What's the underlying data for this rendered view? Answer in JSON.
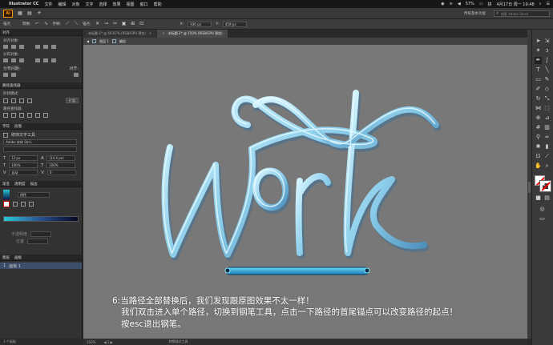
{
  "menubar": {
    "app_name": "Illustrator CC",
    "items": [
      "文件",
      "编辑",
      "对象",
      "文字",
      "选择",
      "效果",
      "视图",
      "窗口",
      "帮助"
    ],
    "battery": "57%",
    "date_time": "4月17日 周一 19:48"
  },
  "appbar": {
    "logo": "Ai",
    "workspace": "传统基本功能",
    "search_placeholder": "搜索 Adobe Stock"
  },
  "control_bar": {
    "selection_label": "锚点",
    "convert_label": "转换:",
    "handles_label": "手柄:",
    "anchor_label": "锚点:",
    "x_value": "936 px",
    "y_value": "459 px"
  },
  "doc_tabs": [
    {
      "label": "未标题-1* @ 66.67% (RGB/GPU 预览)",
      "active": false
    },
    {
      "label": "未标题-2* @ 150% (RGB/GPU 预览)",
      "active": true
    }
  ],
  "breadcrumb": {
    "layer": "图层 1",
    "group": "编组"
  },
  "left_panel": {
    "align_tab": "对齐",
    "align_objects_label": "对齐对象:",
    "distribute_objects_label": "分布对象:",
    "distribute_spacing_label": "分布间距:",
    "align_to_label": "对齐:",
    "pathfinder_tab": "路径查找器",
    "shape_modes_label": "形状模式:",
    "expand_button": "扩展",
    "pathfinders_label": "路径查找器:",
    "char_tab": "字符",
    "para_tab": "段落",
    "touch_type_label": "修饰文字工具",
    "font_family": "Adobe 宋体 Std L",
    "font_size": "12 px",
    "leading": "(14.4 px)",
    "scale_h": "100%",
    "scale_v": "100%",
    "tracking_auto": "自动",
    "tracking": "0",
    "gradient_tab": "渐变",
    "transparency_tab": "透明度",
    "stroke_tab": "描边",
    "gradient_type": "线性",
    "opacity_label": "不透明度",
    "position_label": "位置",
    "layers_tab": "图层",
    "artboards_tab": "画板",
    "artboard_name": "画板 1",
    "artboard_number": "1",
    "panel_count": "1 个画板"
  },
  "status_bar": {
    "zoom": "150%",
    "tool": "转换锚点工具"
  },
  "canvas": {
    "artwork_text": "Work",
    "caption_lines": [
      "6:当路径全部替换后，我们发现跟原图效果不太一样！",
      "我们双击进入单个路径，切换到钢笔工具，点击一下路径的首尾锚点可以改变路径的起点！",
      "按esc退出钢笔。"
    ]
  },
  "colors": {
    "canvas_bg": "#787878",
    "stroke_light": "#b8eef8",
    "stroke_mid": "#7cc6e4",
    "stroke_dark": "#3e7eae",
    "highlight_bar": "#22a8d8",
    "ai_orange": "#ff9a00"
  }
}
